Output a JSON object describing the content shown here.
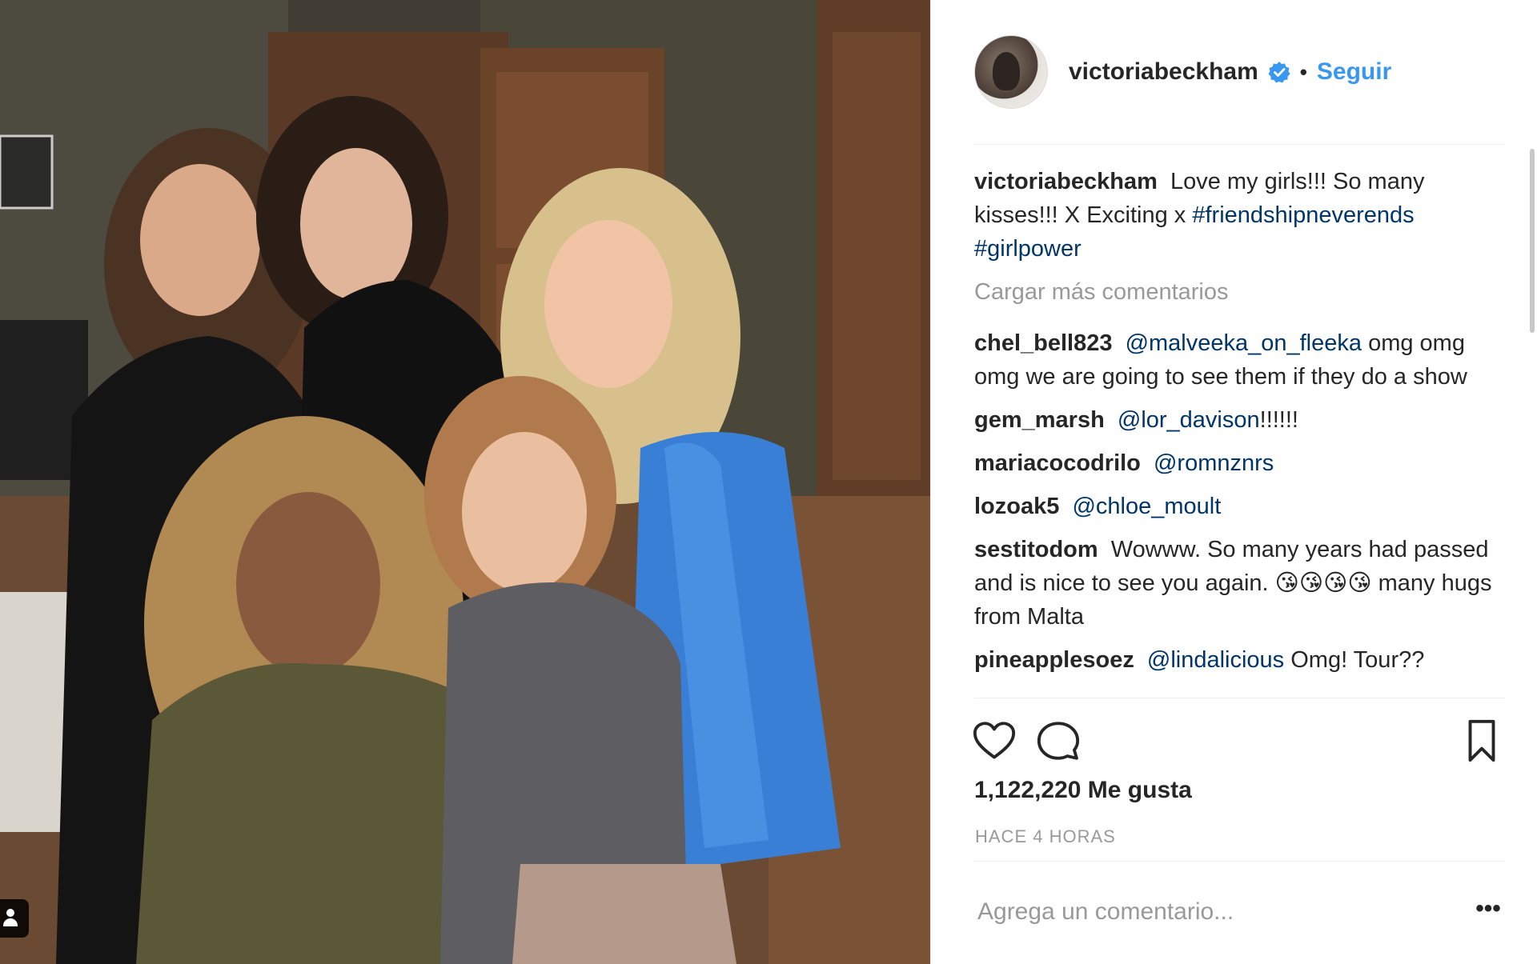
{
  "post": {
    "username": "victoriabeckham",
    "verified": true,
    "follow_label": "Seguir",
    "separator": "•",
    "caption": {
      "user": "victoriabeckham",
      "text": "Love my girls!!! So many kisses!!! X Exciting x",
      "tags": [
        "#friendshipneverends",
        "#girlpower"
      ]
    },
    "load_more_label": "Cargar más comentarios",
    "comments": [
      {
        "user": "chel_bell823",
        "mention": "@malveeka_on_fleeka",
        "text": "omg omg omg we are going to see them if they do a show"
      },
      {
        "user": "gem_marsh",
        "mention": "@lor_davison",
        "text": "!!!!!!"
      },
      {
        "user": "mariacocodrilo",
        "mention": "@romnznrs",
        "text": ""
      },
      {
        "user": "lozoak5",
        "mention": "@chloe_moult",
        "text": ""
      },
      {
        "user": "sestitodom",
        "mention": "",
        "text": "Wowww. So many years had passed and is nice to see you again. 😘😘😘😘 many hugs from Malta"
      },
      {
        "user": "pineapplesoez",
        "mention": "@lindalicious",
        "text": "Omg! Tour??"
      }
    ],
    "likes": "1,122,220 Me gusta",
    "timestamp": "HACE 4 HORAS",
    "add_comment_placeholder": "Agrega un comentario...",
    "more_options": "•••"
  },
  "icons": {
    "like": "heart-icon",
    "comment": "comment-bubble-icon",
    "save": "bookmark-icon",
    "verified": "verified-badge-icon",
    "user_tag": "user-tag-icon"
  },
  "colors": {
    "link_blue": "#3897f0",
    "mention_blue": "#003569",
    "muted": "#999999",
    "text": "#262626"
  }
}
